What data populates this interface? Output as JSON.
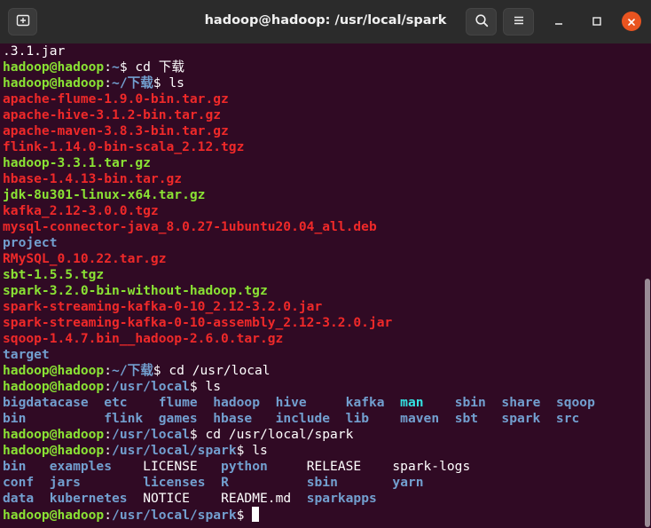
{
  "window": {
    "title": "hadoop@hadoop: /usr/local/spark"
  },
  "icons": {
    "new_tab": "new-tab-icon",
    "search": "search-icon",
    "menu": "hamburger-menu-icon",
    "minimize": "minimize-icon",
    "maximize": "maximize-icon",
    "close": "close-icon"
  },
  "colors": {
    "background": "#300a24",
    "user": "#8ae234",
    "directory": "#729fcf",
    "archive": "#ef2929",
    "close_button": "#e95420"
  },
  "terminal": {
    "lines": [
      {
        "segments": [
          {
            "text": ".3.1.jar",
            "style": "file"
          }
        ]
      },
      {
        "segments": [
          {
            "text": "hadoop@hadoop",
            "style": "user"
          },
          {
            "text": ":",
            "style": "file"
          },
          {
            "text": "~",
            "style": "path"
          },
          {
            "text": "$ cd 下载",
            "style": "file"
          }
        ]
      },
      {
        "segments": [
          {
            "text": "hadoop@hadoop",
            "style": "user"
          },
          {
            "text": ":",
            "style": "file"
          },
          {
            "text": "~/下载",
            "style": "path"
          },
          {
            "text": "$ ls",
            "style": "file"
          }
        ]
      },
      {
        "segments": [
          {
            "text": "apache-flume-1.9.0-bin.tar.gz",
            "style": "archive"
          }
        ]
      },
      {
        "segments": [
          {
            "text": "apache-hive-3.1.2-bin.tar.gz",
            "style": "archive"
          }
        ]
      },
      {
        "segments": [
          {
            "text": "apache-maven-3.8.3-bin.tar.gz",
            "style": "archive"
          }
        ]
      },
      {
        "segments": [
          {
            "text": "flink-1.14.0-bin-scala_2.12.tgz",
            "style": "archive"
          }
        ]
      },
      {
        "segments": [
          {
            "text": "hadoop-3.3.1.tar.gz",
            "style": "green"
          }
        ]
      },
      {
        "segments": [
          {
            "text": "hbase-1.4.13-bin.tar.gz",
            "style": "archive"
          }
        ]
      },
      {
        "segments": [
          {
            "text": "jdk-8u301-linux-x64.tar.gz",
            "style": "green"
          }
        ]
      },
      {
        "segments": [
          {
            "text": "kafka_2.12-3.0.0.tgz",
            "style": "archive"
          }
        ]
      },
      {
        "segments": [
          {
            "text": "mysql-connector-java_8.0.27-1ubuntu20.04_all.deb",
            "style": "archive"
          }
        ]
      },
      {
        "segments": [
          {
            "text": "project",
            "style": "dir"
          }
        ]
      },
      {
        "segments": [
          {
            "text": "RMySQL_0.10.22.tar.gz",
            "style": "archive"
          }
        ]
      },
      {
        "segments": [
          {
            "text": "sbt-1.5.5.tgz",
            "style": "green"
          }
        ]
      },
      {
        "segments": [
          {
            "text": "spark-3.2.0-bin-without-hadoop.tgz",
            "style": "green"
          }
        ]
      },
      {
        "segments": [
          {
            "text": "spark-streaming-kafka-0-10_2.12-3.2.0.jar",
            "style": "archive"
          }
        ]
      },
      {
        "segments": [
          {
            "text": "spark-streaming-kafka-0-10-assembly_2.12-3.2.0.jar",
            "style": "archive"
          }
        ]
      },
      {
        "segments": [
          {
            "text": "sqoop-1.4.7.bin__hadoop-2.6.0.tar.gz",
            "style": "archive"
          }
        ]
      },
      {
        "segments": [
          {
            "text": "target",
            "style": "dir"
          }
        ]
      },
      {
        "segments": [
          {
            "text": "hadoop@hadoop",
            "style": "user"
          },
          {
            "text": ":",
            "style": "file"
          },
          {
            "text": "~/下载",
            "style": "path"
          },
          {
            "text": "$ cd /usr/local",
            "style": "file"
          }
        ]
      },
      {
        "segments": [
          {
            "text": "hadoop@hadoop",
            "style": "user"
          },
          {
            "text": ":",
            "style": "file"
          },
          {
            "text": "/usr/local",
            "style": "path"
          },
          {
            "text": "$ ls",
            "style": "file"
          }
        ]
      },
      {
        "segments": [
          {
            "text": "bigdatacase",
            "style": "dir"
          },
          {
            "text": "  ",
            "style": "file"
          },
          {
            "text": "etc",
            "style": "dir"
          },
          {
            "text": "    ",
            "style": "file"
          },
          {
            "text": "flume",
            "style": "dir"
          },
          {
            "text": "  ",
            "style": "file"
          },
          {
            "text": "hadoop",
            "style": "dir"
          },
          {
            "text": "  ",
            "style": "file"
          },
          {
            "text": "hive",
            "style": "dir"
          },
          {
            "text": "     ",
            "style": "file"
          },
          {
            "text": "kafka",
            "style": "dir"
          },
          {
            "text": "  ",
            "style": "file"
          },
          {
            "text": "man",
            "style": "exec"
          },
          {
            "text": "    ",
            "style": "file"
          },
          {
            "text": "sbin",
            "style": "dir"
          },
          {
            "text": "  ",
            "style": "file"
          },
          {
            "text": "share",
            "style": "dir"
          },
          {
            "text": "  ",
            "style": "file"
          },
          {
            "text": "sqoop",
            "style": "dir"
          }
        ]
      },
      {
        "segments": [
          {
            "text": "bin",
            "style": "dir"
          },
          {
            "text": "          ",
            "style": "file"
          },
          {
            "text": "flink",
            "style": "dir"
          },
          {
            "text": "  ",
            "style": "file"
          },
          {
            "text": "games",
            "style": "dir"
          },
          {
            "text": "  ",
            "style": "file"
          },
          {
            "text": "hbase",
            "style": "dir"
          },
          {
            "text": "   ",
            "style": "file"
          },
          {
            "text": "include",
            "style": "dir"
          },
          {
            "text": "  ",
            "style": "file"
          },
          {
            "text": "lib",
            "style": "dir"
          },
          {
            "text": "    ",
            "style": "file"
          },
          {
            "text": "maven",
            "style": "dir"
          },
          {
            "text": "  ",
            "style": "file"
          },
          {
            "text": "sbt",
            "style": "dir"
          },
          {
            "text": "   ",
            "style": "file"
          },
          {
            "text": "spark",
            "style": "dir"
          },
          {
            "text": "  ",
            "style": "file"
          },
          {
            "text": "src",
            "style": "dir"
          }
        ]
      },
      {
        "segments": [
          {
            "text": "hadoop@hadoop",
            "style": "user"
          },
          {
            "text": ":",
            "style": "file"
          },
          {
            "text": "/usr/local",
            "style": "path"
          },
          {
            "text": "$ cd /usr/local/spark",
            "style": "file"
          }
        ]
      },
      {
        "segments": [
          {
            "text": "hadoop@hadoop",
            "style": "user"
          },
          {
            "text": ":",
            "style": "file"
          },
          {
            "text": "/usr/local/spark",
            "style": "path"
          },
          {
            "text": "$ ls",
            "style": "file"
          }
        ]
      },
      {
        "segments": [
          {
            "text": "bin",
            "style": "dir"
          },
          {
            "text": "   ",
            "style": "file"
          },
          {
            "text": "examples",
            "style": "dir"
          },
          {
            "text": "    ",
            "style": "file"
          },
          {
            "text": "LICENSE",
            "style": "file"
          },
          {
            "text": "   ",
            "style": "file"
          },
          {
            "text": "python",
            "style": "dir"
          },
          {
            "text": "     ",
            "style": "file"
          },
          {
            "text": "RELEASE",
            "style": "file"
          },
          {
            "text": "    ",
            "style": "file"
          },
          {
            "text": "spark-logs",
            "style": "file"
          }
        ]
      },
      {
        "segments": [
          {
            "text": "conf",
            "style": "dir"
          },
          {
            "text": "  ",
            "style": "file"
          },
          {
            "text": "jars",
            "style": "dir"
          },
          {
            "text": "        ",
            "style": "file"
          },
          {
            "text": "licenses",
            "style": "dir"
          },
          {
            "text": "  ",
            "style": "file"
          },
          {
            "text": "R",
            "style": "dir"
          },
          {
            "text": "          ",
            "style": "file"
          },
          {
            "text": "sbin",
            "style": "dir"
          },
          {
            "text": "       ",
            "style": "file"
          },
          {
            "text": "yarn",
            "style": "dir"
          }
        ]
      },
      {
        "segments": [
          {
            "text": "data",
            "style": "dir"
          },
          {
            "text": "  ",
            "style": "file"
          },
          {
            "text": "kubernetes",
            "style": "dir"
          },
          {
            "text": "  ",
            "style": "file"
          },
          {
            "text": "NOTICE",
            "style": "file"
          },
          {
            "text": "    ",
            "style": "file"
          },
          {
            "text": "README.md",
            "style": "file"
          },
          {
            "text": "  ",
            "style": "file"
          },
          {
            "text": "sparkapps",
            "style": "dir"
          }
        ]
      },
      {
        "segments": [
          {
            "text": "hadoop@hadoop",
            "style": "user"
          },
          {
            "text": ":",
            "style": "file"
          },
          {
            "text": "/usr/local/spark",
            "style": "path"
          },
          {
            "text": "$ ",
            "style": "file"
          }
        ],
        "cursor": true
      }
    ]
  }
}
